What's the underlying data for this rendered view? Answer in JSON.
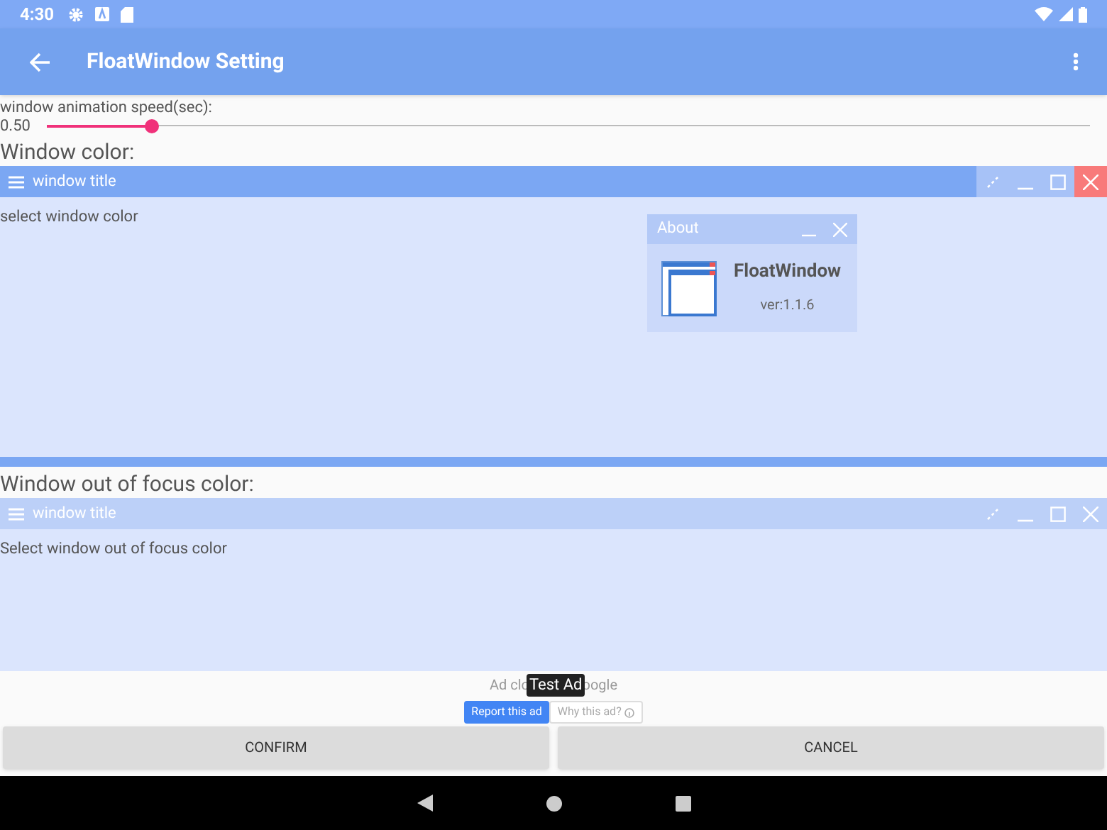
{
  "status_bar": {
    "time": "4:30"
  },
  "app_bar": {
    "title": "FloatWindow Setting"
  },
  "speed": {
    "label": "window animation speed(sec):",
    "reading": "0.50",
    "level": 0.1
  },
  "window_color": {
    "heading": "Window color:",
    "window_title": "window title",
    "hint": "select window color",
    "focused": true
  },
  "about": {
    "title": "About",
    "app_name": "FloatWindow",
    "version": "ver:1.1.6"
  },
  "focus_color": {
    "heading": "Window out of focus color:",
    "window_title": "window title",
    "hint": "Select window out of focus color",
    "focused": false
  },
  "ad": {
    "text_left": "Ad clo",
    "badge": "Test Ad",
    "text_right": "oogle",
    "report": "Report this ad",
    "why": "Why this ad?"
  },
  "buttons": [
    {
      "label": "CONFIRM"
    },
    {
      "label": "CANCEL"
    }
  ]
}
